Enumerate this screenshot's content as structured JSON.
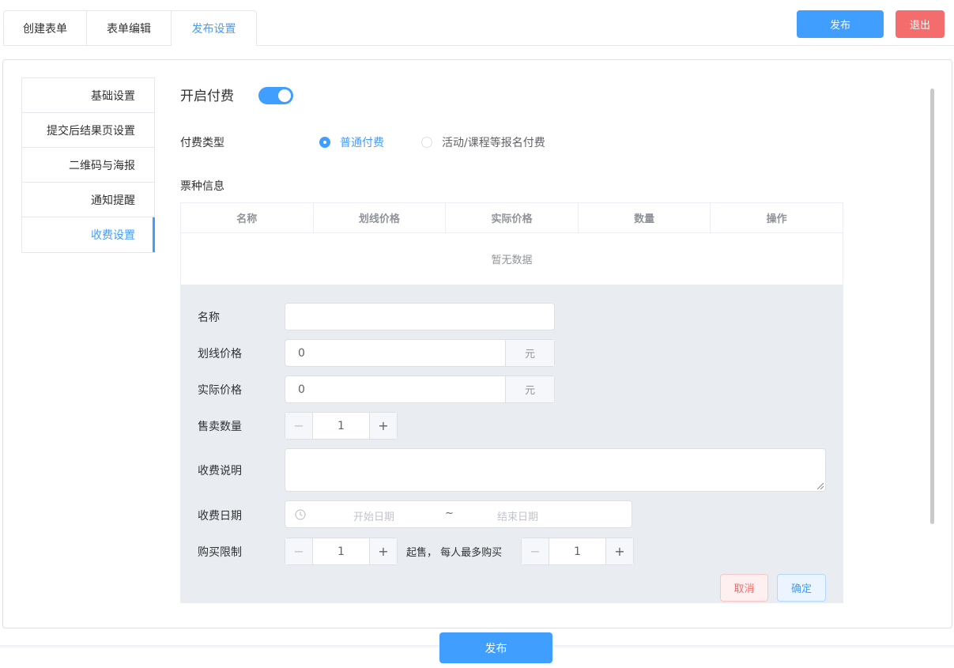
{
  "tabs": [
    {
      "label": "创建表单"
    },
    {
      "label": "表单编辑"
    },
    {
      "label": "发布设置"
    }
  ],
  "header": {
    "publish_label": "发布",
    "exit_label": "退出"
  },
  "sidebar": {
    "items": [
      {
        "label": "基础设置"
      },
      {
        "label": "提交后结果页设置"
      },
      {
        "label": "二维码与海报"
      },
      {
        "label": "通知提醒"
      },
      {
        "label": "收费设置"
      }
    ]
  },
  "payment": {
    "title": "开启付费",
    "enabled": true,
    "type_label": "付费类型",
    "type_options": [
      "普通付费",
      "活动/课程等报名付费"
    ],
    "selected_type": "普通付费"
  },
  "ticket": {
    "label": "票种信息",
    "columns": [
      "名称",
      "划线价格",
      "实际价格",
      "数量",
      "操作"
    ],
    "empty_text": "暂无数据"
  },
  "form": {
    "name_label": "名称",
    "name_value": "",
    "list_price_label": "划线价格",
    "list_price_value": "0",
    "actual_price_label": "实际价格",
    "actual_price_value": "0",
    "currency_suffix": "元",
    "quantity_label": "售卖数量",
    "quantity_value": "1",
    "desc_label": "收费说明",
    "date_label": "收费日期",
    "date_start_placeholder": "开始日期",
    "date_separator": "~",
    "date_end_placeholder": "结束日期",
    "limit_label": "购买限制",
    "limit_min_value": "1",
    "limit_text": "起售， 每人最多购买",
    "limit_max_value": "1",
    "cancel_label": "取消",
    "ok_label": "确定"
  },
  "footer": {
    "publish_label": "发布"
  },
  "colors": {
    "primary": "#409eff",
    "danger": "#f56c6c"
  }
}
